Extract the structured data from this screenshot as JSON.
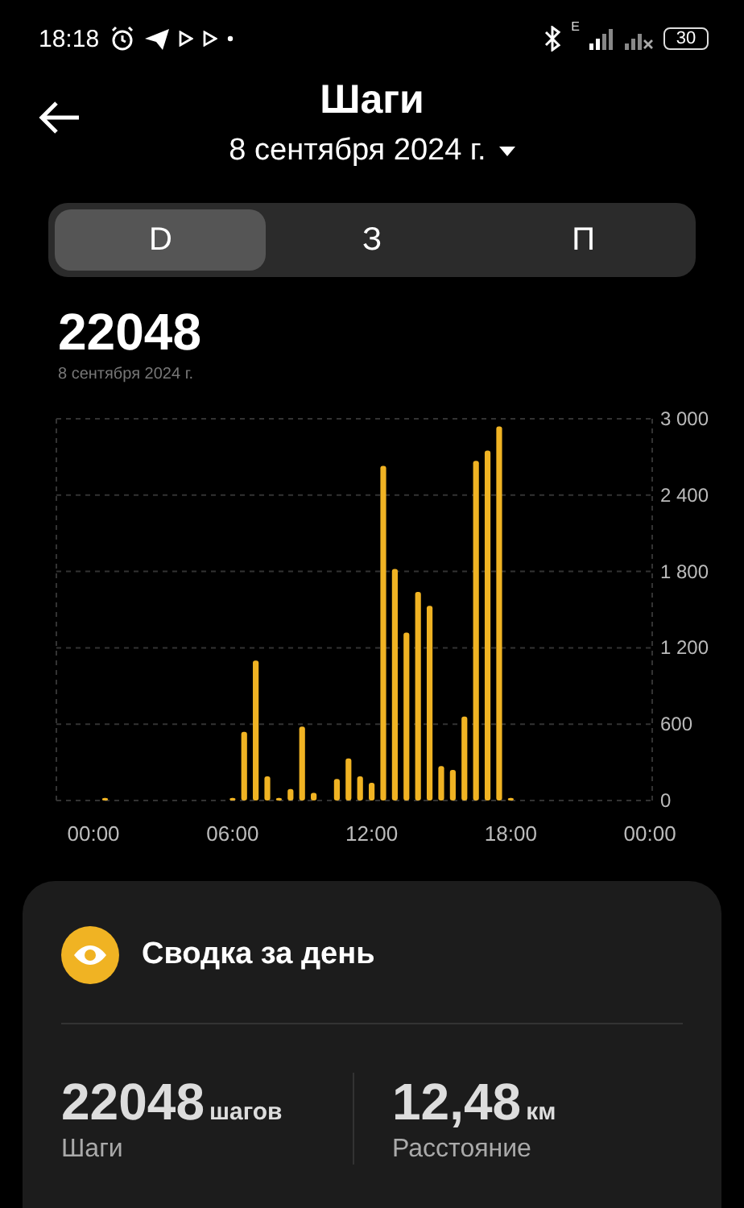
{
  "status_bar": {
    "time": "18:18",
    "network": "E",
    "battery": "30"
  },
  "header": {
    "title": "Шаги",
    "date": "8 сентября 2024 г."
  },
  "tabs": [
    {
      "label": "D",
      "selected": true
    },
    {
      "label": "З",
      "selected": false
    },
    {
      "label": "П",
      "selected": false
    }
  ],
  "total": {
    "value": "22048",
    "date": "8 сентября 2024 г."
  },
  "chart_data": {
    "type": "bar",
    "xlim": [
      -1.6,
      24.1
    ],
    "grid": true,
    "ylim": [
      0,
      3000
    ],
    "x": [
      0.5,
      6,
      6.5,
      7,
      7.5,
      8,
      8.5,
      9,
      9.5,
      10.5,
      11,
      11.5,
      12,
      12.5,
      13,
      13.5,
      14,
      14.5,
      15,
      15.5,
      16,
      16.5,
      17,
      17.5,
      18
    ],
    "series": [
      {
        "color": "#f0b323",
        "values": [
          20,
          20,
          540,
          1100,
          190,
          20,
          90,
          580,
          60,
          170,
          330,
          190,
          140,
          2630,
          1820,
          1320,
          1640,
          1530,
          270,
          240,
          660,
          2670,
          2750,
          2940,
          20
        ]
      }
    ],
    "xticks": [
      {
        "value": 0,
        "label": "00:00"
      },
      {
        "value": 6,
        "label": "06:00"
      },
      {
        "value": 12,
        "label": "12:00"
      },
      {
        "value": 18,
        "label": "18:00"
      },
      {
        "value": 24,
        "label": "00:00"
      }
    ],
    "yticks": [
      {
        "value": 0,
        "label": "0"
      },
      {
        "value": 600,
        "label": "600"
      },
      {
        "value": 1200,
        "label": "1 200"
      },
      {
        "value": 1800,
        "label": "1 800"
      },
      {
        "value": 2400,
        "label": "2 400"
      },
      {
        "value": 3000,
        "label": "3 000"
      }
    ]
  },
  "summary": {
    "title": "Сводка за день",
    "stats": [
      {
        "value": "22048",
        "unit": "шагов",
        "label": "Шаги"
      },
      {
        "value": "12,48",
        "unit": "км",
        "label": "Расстояние"
      }
    ]
  }
}
